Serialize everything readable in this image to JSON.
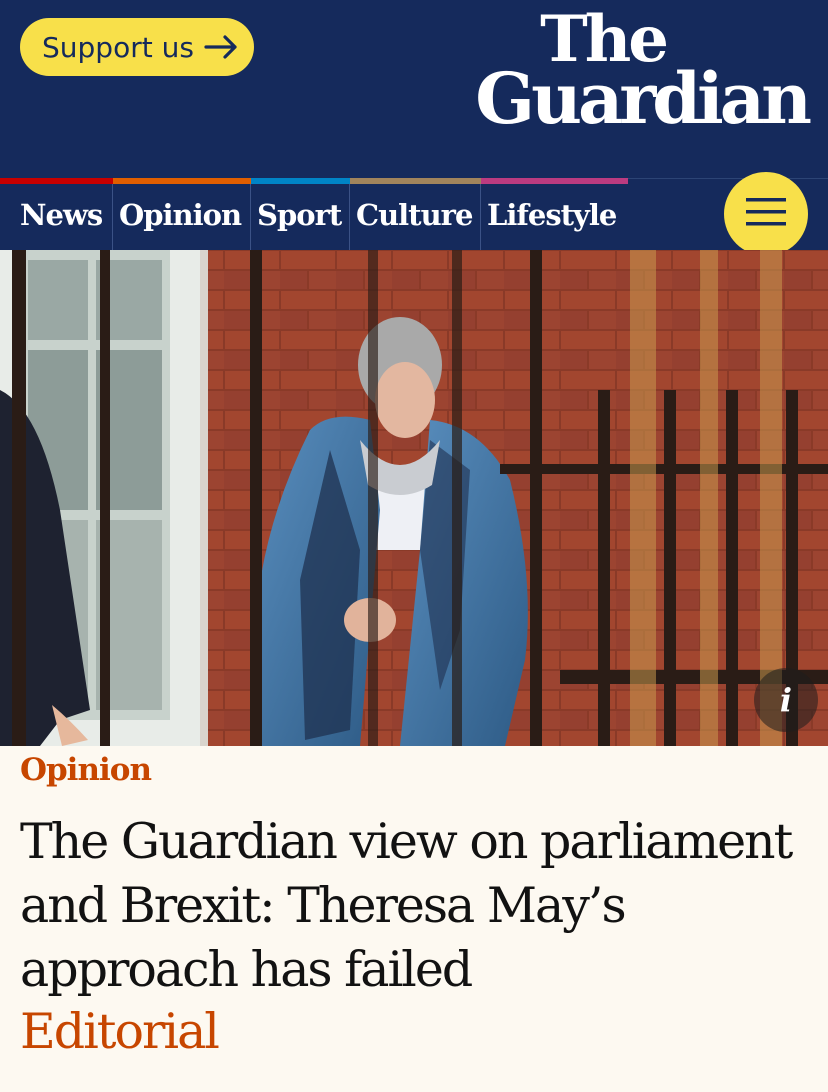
{
  "header": {
    "support_label": "Support us",
    "logo_top": "The",
    "logo_bottom": "Guardian"
  },
  "nav": {
    "items": [
      {
        "label": "News",
        "color": "#c70000"
      },
      {
        "label": "Opinion",
        "color": "#e05e00"
      },
      {
        "label": "Sport",
        "color": "#0084c6"
      },
      {
        "label": "Culture",
        "color": "#a1845c"
      },
      {
        "label": "Lifestyle",
        "color": "#bb3b80"
      }
    ],
    "menu_icon": "hamburger-icon"
  },
  "hero": {
    "info_icon": "info-icon",
    "info_label": "i"
  },
  "article": {
    "kicker": "Opinion",
    "headline": "The Guardian view on parliament and Brexit: Theresa May’s approach has failed",
    "standfirst": "Editorial"
  },
  "colors": {
    "brand": "#152a5c",
    "accent": "#f8e04a",
    "opinion": "#c74600"
  }
}
